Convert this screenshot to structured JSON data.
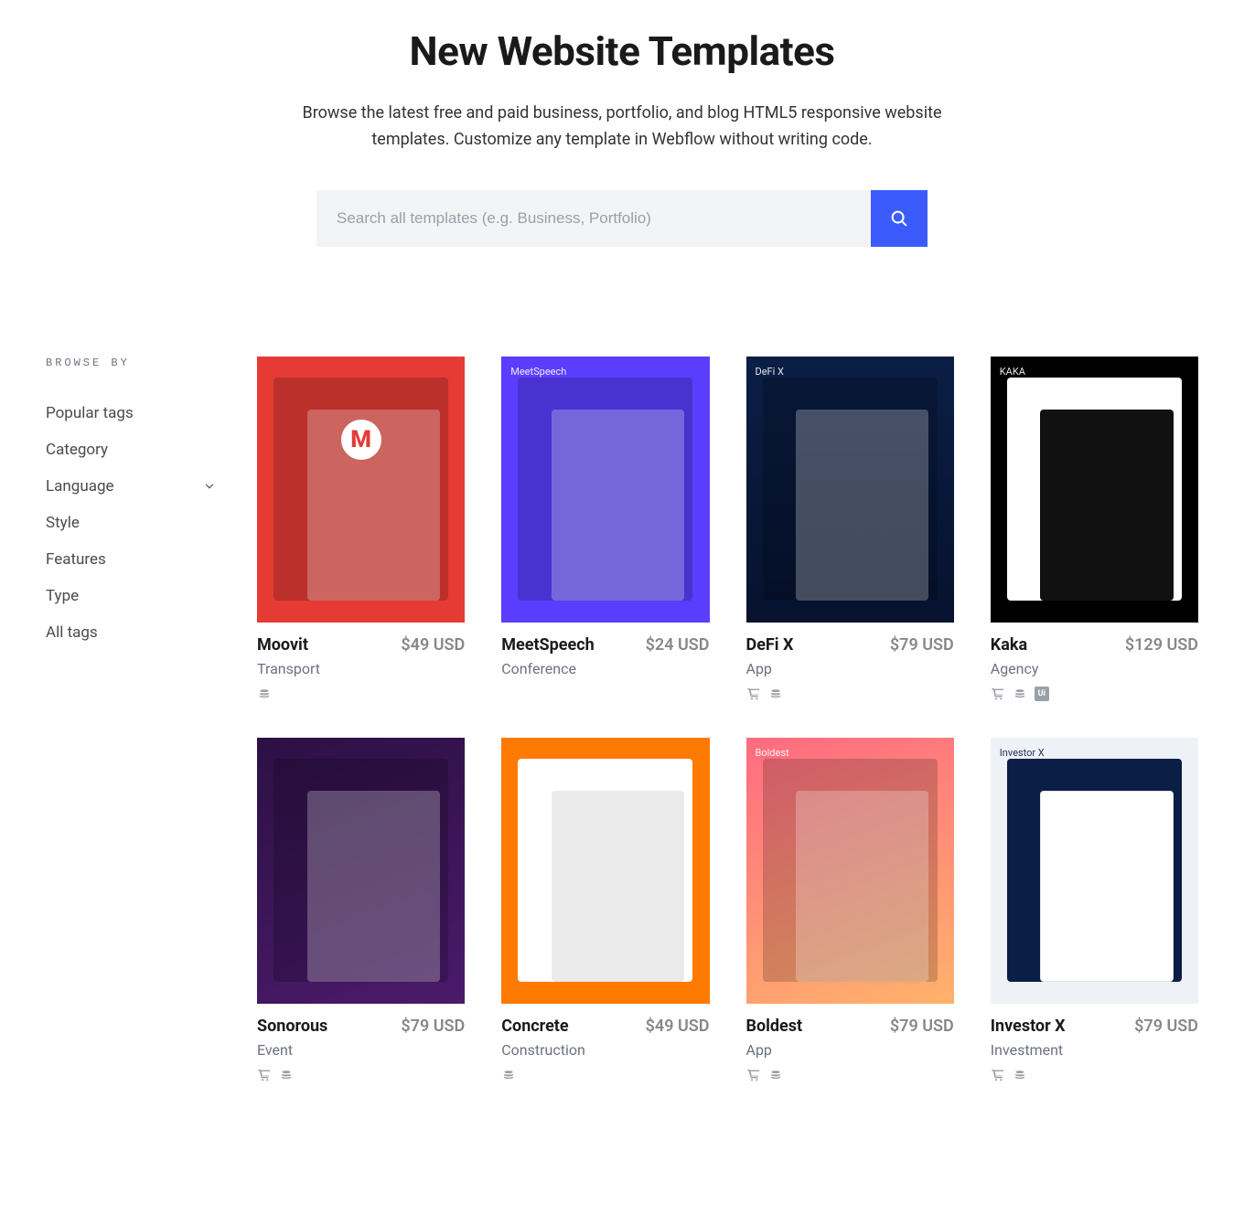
{
  "hero": {
    "title": "New Website Templates",
    "subtitle": "Browse the latest free and paid business, portfolio, and blog HTML5 responsive website templates. Customize any template in Webflow without writing code."
  },
  "search": {
    "placeholder": "Search all templates (e.g. Business, Portfolio)"
  },
  "sidebar": {
    "heading": "BROWSE BY",
    "items": [
      {
        "label": "Popular tags",
        "expandable": false
      },
      {
        "label": "Category",
        "expandable": false
      },
      {
        "label": "Language",
        "expandable": true
      },
      {
        "label": "Style",
        "expandable": false
      },
      {
        "label": "Features",
        "expandable": false
      },
      {
        "label": "Type",
        "expandable": false
      },
      {
        "label": "All tags",
        "expandable": false
      }
    ]
  },
  "templates": [
    {
      "name": "Moovit",
      "category": "Transport",
      "price": "$49 USD",
      "thumb_class": "bg-moovit",
      "thumb_label": "",
      "icons": [
        "stack"
      ],
      "big_m": true
    },
    {
      "name": "MeetSpeech",
      "category": "Conference",
      "price": "$24 USD",
      "thumb_class": "bg-meetspeech",
      "thumb_label": "MeetSpeech",
      "icons": []
    },
    {
      "name": "DeFi X",
      "category": "App",
      "price": "$79 USD",
      "thumb_class": "bg-defi",
      "thumb_label": "DeFi X",
      "icons": [
        "cart",
        "stack"
      ]
    },
    {
      "name": "Kaka",
      "category": "Agency",
      "price": "$129 USD",
      "thumb_class": "bg-kaka",
      "thumb_label": "KAKA",
      "icons": [
        "cart",
        "stack",
        "ui"
      ]
    },
    {
      "name": "Sonorous",
      "category": "Event",
      "price": "$79 USD",
      "thumb_class": "bg-sonorous",
      "thumb_label": "",
      "icons": [
        "cart",
        "stack"
      ]
    },
    {
      "name": "Concrete",
      "category": "Construction",
      "price": "$49 USD",
      "thumb_class": "bg-concrete",
      "thumb_label": "",
      "icons": [
        "stack"
      ]
    },
    {
      "name": "Boldest",
      "category": "App",
      "price": "$79 USD",
      "thumb_class": "bg-boldest",
      "thumb_label": "Boldest",
      "icons": [
        "cart",
        "stack"
      ]
    },
    {
      "name": "Investor X",
      "category": "Investment",
      "price": "$79 USD",
      "thumb_class": "bg-investor",
      "thumb_label": "Investor X",
      "icons": [
        "cart",
        "stack"
      ]
    }
  ]
}
